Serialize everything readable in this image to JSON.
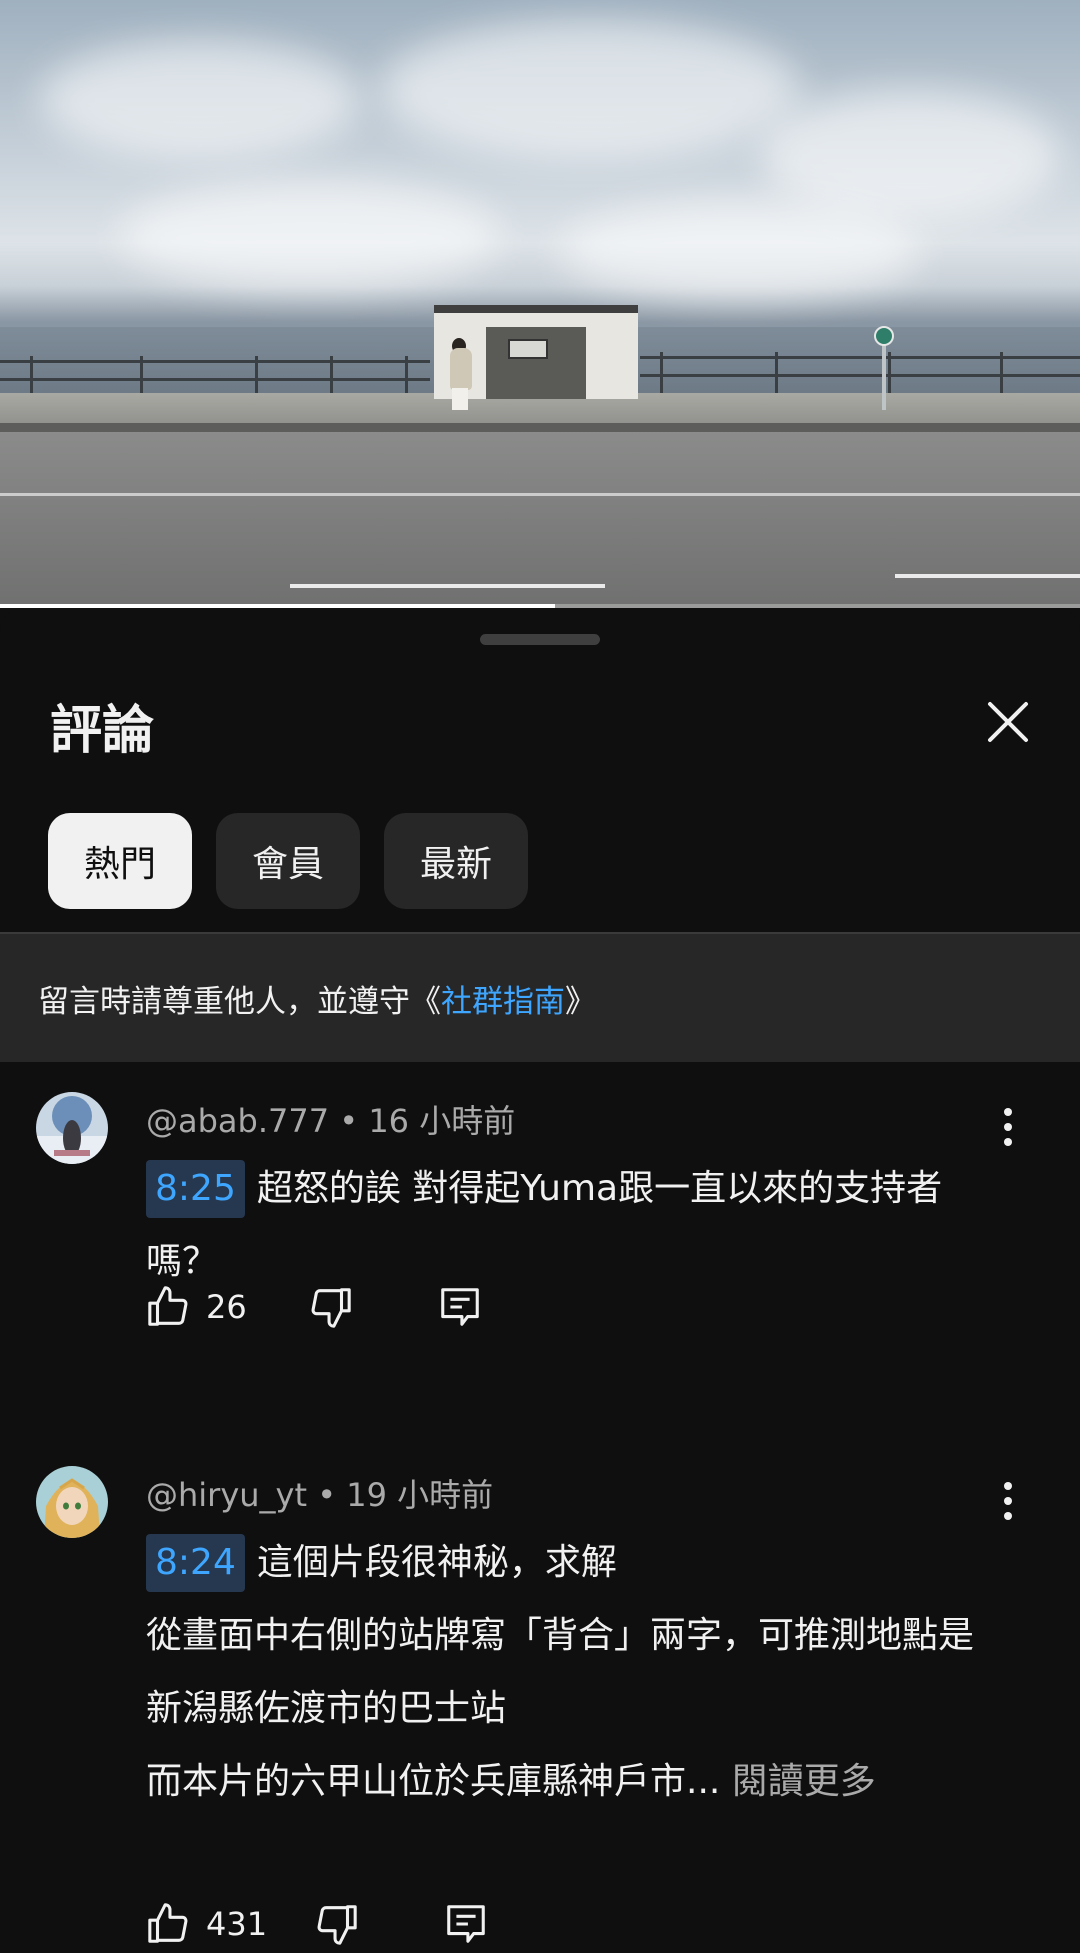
{
  "video": {
    "progress_fraction": 0.514
  },
  "sheet": {
    "title": "評論",
    "close_icon": "close-icon"
  },
  "tabs": [
    {
      "label": "熱門",
      "active": true
    },
    {
      "label": "會員",
      "active": false
    },
    {
      "label": "最新",
      "active": false
    }
  ],
  "notice": {
    "text": "留言時請尊重他人，並遵守《",
    "link": "社群指南",
    "suffix": "》"
  },
  "comments": [
    {
      "author": "@abab.777",
      "separator": " • ",
      "time": "16 小時前",
      "timestamp": "8:25",
      "text_lines": [
        "超怒的誒 對得起Yuma跟一直以來的支持者嗎？"
      ],
      "likes": "26",
      "read_more": ""
    },
    {
      "author": "@hiryu_yt",
      "separator": " • ",
      "time": "19 小時前",
      "timestamp": "8:24",
      "text_first": "這個片段很神秘，求解",
      "text_line2": "從畫面中右側的站牌寫「背合」兩字，可推測地點是新潟縣佐渡市的巴士站",
      "text_line3": "而本片的六甲山位於兵庫縣神戶市...",
      "read_more": " 閱讀更多",
      "likes": "431"
    }
  ],
  "colors": {
    "background": "#0f0f0f",
    "chip_inactive": "#272727",
    "chip_active": "#f1f1f1",
    "link": "#3ea6ff",
    "timestamp_bg": "#263850",
    "secondary_text": "#aaaaaa"
  }
}
